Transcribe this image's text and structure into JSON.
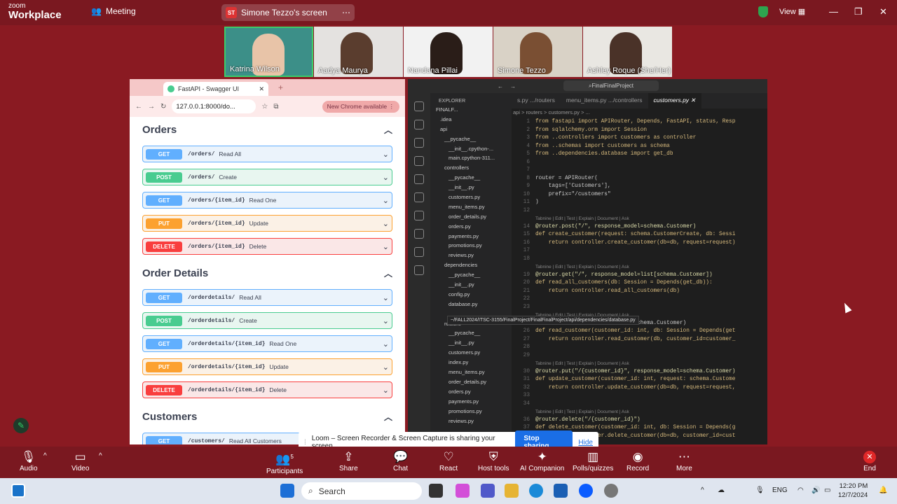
{
  "zoom": {
    "brand_top": "zoom",
    "brand_bottom": "Workplace",
    "meeting_label": "Meeting",
    "share_avatar": "ST",
    "share_title": "Simone Tezzo's screen",
    "view_label": "View",
    "participants": [
      {
        "name": "Katrina Wilson"
      },
      {
        "name": "Aadya Maurya"
      },
      {
        "name": "Nandana Pillai"
      },
      {
        "name": "Simone Tezzo"
      },
      {
        "name": "Ashley Roque (She/Her)"
      }
    ],
    "toolbar": {
      "audio": "Audio",
      "video": "Video",
      "participants": "Participants",
      "participants_count": "5",
      "share": "Share",
      "chat": "Chat",
      "react": "React",
      "host_tools": "Host tools",
      "ai_companion": "AI Companion",
      "polls": "Polls/quizzes",
      "record": "Record",
      "more": "More",
      "end": "End"
    }
  },
  "browser": {
    "tab_title": "FastAPI - Swagger UI",
    "url": "127.0.0.1:8000/do...",
    "new_chrome": "New Chrome available"
  },
  "swagger": {
    "sections": [
      {
        "title": "Orders",
        "ops": [
          {
            "method": "GET",
            "path": "/orders/",
            "summary": "Read All"
          },
          {
            "method": "POST",
            "path": "/orders/",
            "summary": "Create"
          },
          {
            "method": "GET",
            "path": "/orders/{item_id}",
            "summary": "Read One"
          },
          {
            "method": "PUT",
            "path": "/orders/{item_id}",
            "summary": "Update"
          },
          {
            "method": "DELETE",
            "path": "/orders/{item_id}",
            "summary": "Delete"
          }
        ]
      },
      {
        "title": "Order Details",
        "ops": [
          {
            "method": "GET",
            "path": "/orderdetails/",
            "summary": "Read All"
          },
          {
            "method": "POST",
            "path": "/orderdetails/",
            "summary": "Create"
          },
          {
            "method": "GET",
            "path": "/orderdetails/{item_id}",
            "summary": "Read One"
          },
          {
            "method": "PUT",
            "path": "/orderdetails/{item_id}",
            "summary": "Update"
          },
          {
            "method": "DELETE",
            "path": "/orderdetails/{item_id}",
            "summary": "Delete"
          }
        ]
      },
      {
        "title": "Customers",
        "ops": [
          {
            "method": "GET",
            "path": "/customers/",
            "summary": "Read All Customers"
          }
        ]
      }
    ]
  },
  "vscode": {
    "search": "FinalFinalProject",
    "tabs": [
      "s.py .../routers",
      "menu_items.py .../controllers",
      "customers.py"
    ],
    "explorer_title": "EXPLORER",
    "breadcrumb": "api > routers > customers.py > ...",
    "tree": [
      "FINALF...",
      ".idea",
      "api",
      "__pycache__",
      "__init__.cpython-...",
      "main.cpython-311...",
      "controllers",
      "__pycache__",
      "__init__.py",
      "customers.py",
      "menu_items.py",
      "order_details.py",
      "orders.py",
      "payments.py",
      "promotions.py",
      "reviews.py",
      "dependencies",
      "__pycache__",
      "__init__.py",
      "config.py",
      "database.py",
      "",
      "routers",
      "__pycache__",
      "__init__.py",
      "customers.py",
      "index.py",
      "menu_items.py",
      "order_details.py",
      "orders.py",
      "payments.py",
      "promotions.py",
      "reviews.py"
    ],
    "tooltip": "~/FALL2024/ITSC-3155/FinalProject/FinalFinalProject/api/dependencies/database.py",
    "code": [
      {
        "n": "1",
        "t": "from fastapi import APIRouter, Depends, FastAPI, status, Resp"
      },
      {
        "n": "2",
        "t": "from sqlalchemy.orm import Session"
      },
      {
        "n": "3",
        "t": "from ..controllers import customers as controller"
      },
      {
        "n": "4",
        "t": "from ..schemas import customers as schema"
      },
      {
        "n": "5",
        "t": "from ..dependencies.database import get_db"
      },
      {
        "n": "6",
        "t": ""
      },
      {
        "n": "7",
        "t": ""
      },
      {
        "n": "8",
        "t": "router = APIRouter("
      },
      {
        "n": "9",
        "t": "    tags=['Customers'],"
      },
      {
        "n": "10",
        "t": "    prefix=\"/customers\""
      },
      {
        "n": "11",
        "t": ")"
      },
      {
        "n": "12",
        "t": ""
      },
      {
        "n": "",
        "t": "Tabnine | Edit | Test | Explain | Document | Ask"
      },
      {
        "n": "14",
        "t": "@router.post(\"/\", response_model=schema.Customer)"
      },
      {
        "n": "15",
        "t": "def create_customer(request: schema.CustomerCreate, db: Sessi"
      },
      {
        "n": "16",
        "t": "    return controller.create_customer(db=db, request=request)"
      },
      {
        "n": "17",
        "t": ""
      },
      {
        "n": "18",
        "t": ""
      },
      {
        "n": "",
        "t": "Tabnine | Edit | Test | Explain | Document | Ask"
      },
      {
        "n": "19",
        "t": "@router.get(\"/\", response_model=list[schema.Customer])"
      },
      {
        "n": "20",
        "t": "def read_all_customers(db: Session = Depends(get_db)):"
      },
      {
        "n": "21",
        "t": "    return controller.read_all_customers(db)"
      },
      {
        "n": "22",
        "t": ""
      },
      {
        "n": "23",
        "t": ""
      },
      {
        "n": "",
        "t": "Tabnine | Edit | Test | Explain | Document | Ask"
      },
      {
        "n": "25",
        "t": "                        model=schema.Customer)"
      },
      {
        "n": "26",
        "t": "def read_customer(customer_id: int, db: Session = Depends(get"
      },
      {
        "n": "27",
        "t": "    return controller.read_customer(db, customer_id=customer_"
      },
      {
        "n": "28",
        "t": ""
      },
      {
        "n": "29",
        "t": ""
      },
      {
        "n": "",
        "t": "Tabnine | Edit | Test | Explain | Document | Ask"
      },
      {
        "n": "30",
        "t": "@router.put(\"/{customer_id}\", response_model=schema.Customer)"
      },
      {
        "n": "31",
        "t": "def update_customer(customer_id: int, request: schema.Custome"
      },
      {
        "n": "32",
        "t": "    return controller.update_customer(db=db, request=request,"
      },
      {
        "n": "33",
        "t": ""
      },
      {
        "n": "34",
        "t": ""
      },
      {
        "n": "",
        "t": "Tabnine | Edit | Test | Explain | Document | Ask"
      },
      {
        "n": "36",
        "t": "@router.delete(\"/{customer_id}\")"
      },
      {
        "n": "37",
        "t": "def delete_customer(customer_id: int, db: Session = Depends(g"
      },
      {
        "n": "38",
        "t": "    return controller.delete_customer(db=db, customer_id=cust"
      }
    ]
  },
  "loom": {
    "message": "Loom – Screen Recorder & Screen Capture is sharing your screen.",
    "stop": "Stop sharing",
    "hide": "Hide"
  },
  "taskbar": {
    "search": "Search",
    "lang": "ENG",
    "time": "12:20 PM",
    "date": "12/7/2024"
  }
}
